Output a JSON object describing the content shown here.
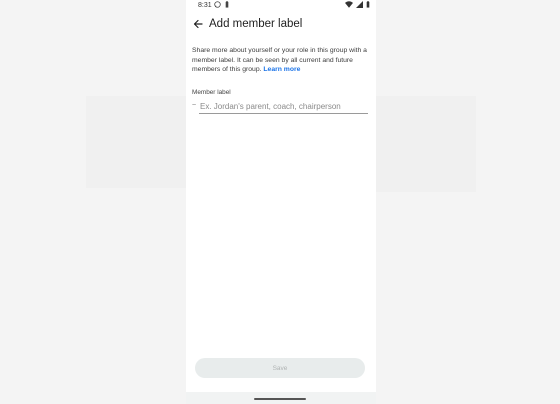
{
  "status_bar": {
    "time": "8:31",
    "left_icons": [
      "whatsapp-icon",
      "battery-saver-icon"
    ],
    "right_icons": [
      "wifi-icon",
      "signal-icon",
      "battery-icon"
    ]
  },
  "app_bar": {
    "back_icon": "arrow-back-icon",
    "title": "Add member label"
  },
  "content": {
    "description": "Share more about yourself or your role in this group with a member label. It can be seen by all current and future members of this group.",
    "learn_more": "Learn more"
  },
  "member_label_field": {
    "label": "Member label",
    "prefix_icon": "tilde-icon",
    "prefix_glyph": "~",
    "value": "",
    "placeholder": "Ex. Jordan's parent, coach, chairperson"
  },
  "footer": {
    "save_label": "Save"
  },
  "colors": {
    "accent": "#1a73e8",
    "save_bg_disabled": "#e8ecec",
    "save_text_disabled": "#b0b4b4"
  }
}
